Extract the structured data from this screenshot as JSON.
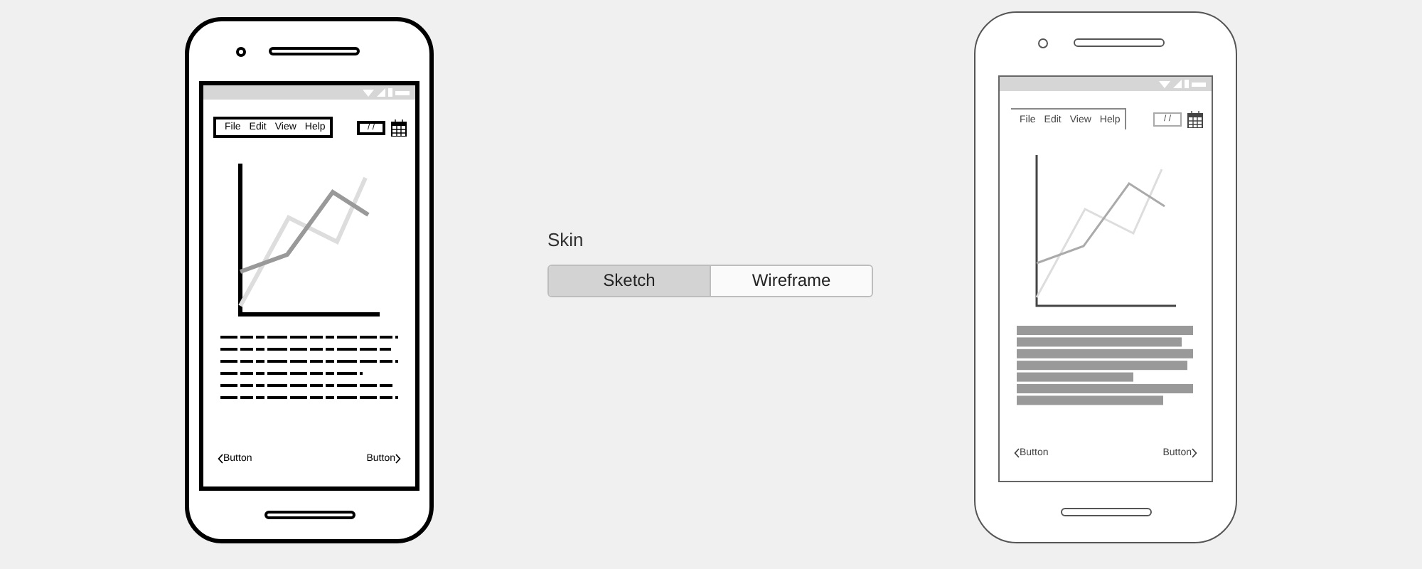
{
  "phones": [
    {
      "kind": "sketch",
      "menu": [
        "File",
        "Edit",
        "View",
        "Help"
      ],
      "date_field": "/ /",
      "buttons": [
        "Button",
        "Button"
      ]
    },
    {
      "kind": "wireframe",
      "menu": [
        "File",
        "Edit",
        "View",
        "Help"
      ],
      "date_field": "/ /",
      "buttons": [
        "Button",
        "Button"
      ]
    }
  ],
  "skin": {
    "label": "Skin",
    "options": [
      {
        "label": "Sketch",
        "selected": true
      },
      {
        "label": "Wireframe",
        "selected": false
      }
    ]
  }
}
